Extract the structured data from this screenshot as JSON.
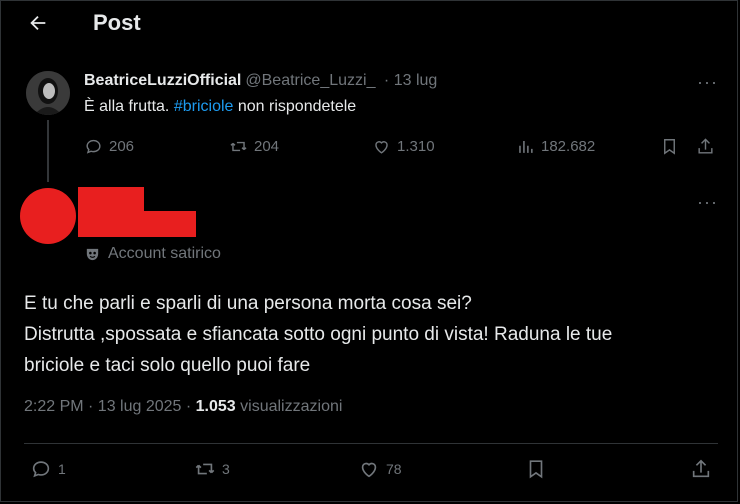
{
  "header": {
    "title": "Post"
  },
  "quoted_post": {
    "display_name": "BeatriceLuzziOfficial",
    "handle": "@Beatrice_Luzzi_",
    "date": "· 13 lug",
    "text_before": "È alla frutta. ",
    "hashtag": "#briciole",
    "text_after": " non rispondetele",
    "stats": {
      "replies": "206",
      "reposts": "204",
      "likes": "1.310",
      "views": "182.682"
    },
    "more_label": "···"
  },
  "main_post": {
    "label": "Account satirico",
    "more_label": "···",
    "lines": [
      "E tu che parli e sparli di una persona morta cosa sei?",
      "Distrutta ,spossata e sfiancata sotto ogni punto di vista! Raduna le tue",
      "briciole e taci solo quello puoi fare"
    ],
    "time": "2:22 PM · 13 lug 2025 · ",
    "views_count": "1.053",
    "views_label": " visualizzazioni",
    "stats": {
      "replies": "1",
      "reposts": "3",
      "likes": "78"
    }
  },
  "colors": {
    "background": "#000000",
    "text": "#e7e9ea",
    "muted": "#71767b",
    "link": "#1d9bf0",
    "redaction": "#e81f1f"
  },
  "icons": [
    "back-arrow-icon",
    "reply-icon",
    "repost-icon",
    "like-icon",
    "views-icon",
    "bookmark-icon",
    "share-icon",
    "satire-mask-icon",
    "more-icon"
  ]
}
